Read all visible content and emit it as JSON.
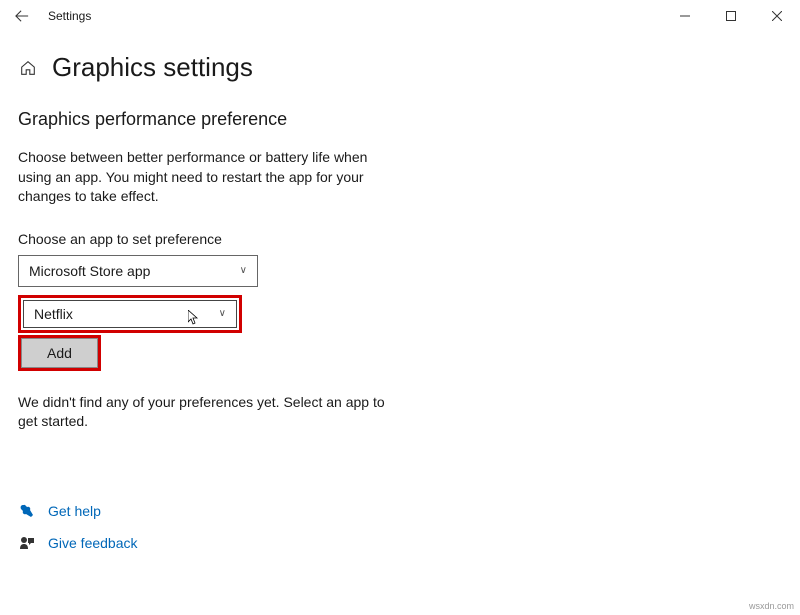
{
  "titlebar": {
    "title": "Settings"
  },
  "page": {
    "title": "Graphics settings"
  },
  "section": {
    "title": "Graphics performance preference",
    "description": "Choose between better performance or battery life when using an app. You might need to restart the app for your changes to take effect."
  },
  "form": {
    "choose_label": "Choose an app to set preference",
    "app_type_selected": "Microsoft Store app",
    "app_selected": "Netflix",
    "add_label": "Add"
  },
  "empty_state": "We didn't find any of your preferences yet. Select an app to get started.",
  "links": {
    "help": "Get help",
    "feedback": "Give feedback"
  },
  "watermark": "wsxdn.com",
  "colors": {
    "accent_link": "#0067b8",
    "highlight": "#d10000"
  }
}
